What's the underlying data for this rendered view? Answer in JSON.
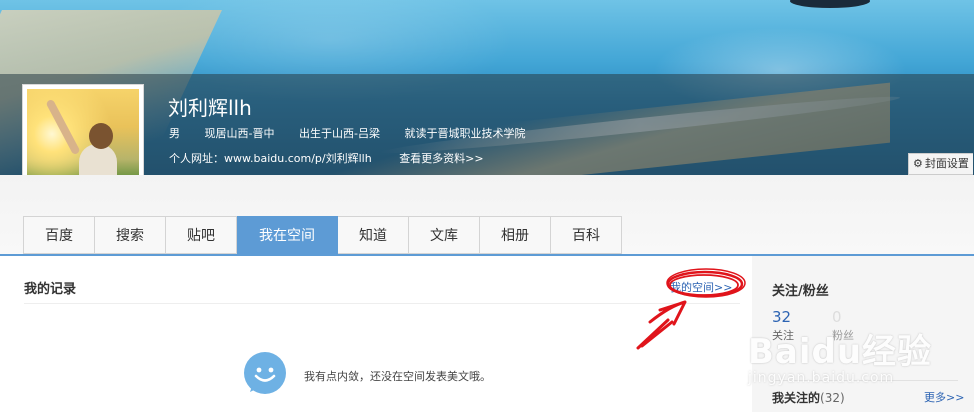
{
  "profile": {
    "name": "刘利辉llh",
    "gender": "男",
    "residence": "现居山西-晋中",
    "birthplace": "出生于山西-吕梁",
    "school": "就读于晋城职业技术学院",
    "url_label": "个人网址：www.baidu.com/p/刘利辉llh",
    "more_info": "查看更多资料>>",
    "cover_setting": "封面设置"
  },
  "nav": {
    "tabs": [
      {
        "label": "百度"
      },
      {
        "label": "搜索"
      },
      {
        "label": "贴吧"
      },
      {
        "label": "我在空间"
      },
      {
        "label": "知道"
      },
      {
        "label": "文库"
      },
      {
        "label": "相册"
      },
      {
        "label": "百科"
      }
    ],
    "active_index": 3,
    "accent_color": "#5d9bd5"
  },
  "main": {
    "title": "我的记录",
    "my_space_link": "我的空间>>",
    "empty_message": "我有点内敛，还没在空间发表美文哦。"
  },
  "sidebar": {
    "title": "关注/粉丝",
    "follow_count": "32",
    "follow_label": "关注",
    "fans_count": "0",
    "fans_label": "粉丝",
    "follow_list_title": "我关注的",
    "follow_list_count": "(32)",
    "more": "更多>>"
  },
  "watermark": {
    "main": "Baidu经验",
    "sub": "jingyan.baidu.com"
  },
  "icons": {
    "gear": "gear-icon",
    "empty": "smiley-bubble-icon"
  }
}
